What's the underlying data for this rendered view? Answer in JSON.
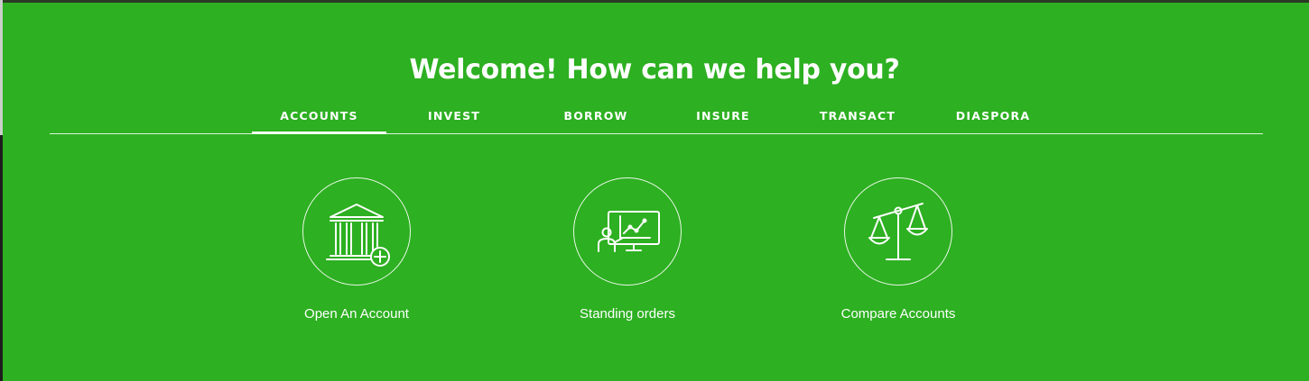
{
  "headline": "Welcome! How can we help you?",
  "tabs": [
    {
      "label": "ACCOUNTS",
      "active": true
    },
    {
      "label": "INVEST",
      "active": false
    },
    {
      "label": "BORROW",
      "active": false
    },
    {
      "label": "INSURE",
      "active": false
    },
    {
      "label": "TRANSACT",
      "active": false
    },
    {
      "label": "DIASPORA",
      "active": false
    }
  ],
  "cards": [
    {
      "label": "Open An Account",
      "icon": "bank-add-icon"
    },
    {
      "label": "Standing orders",
      "icon": "presentation-chart-icon"
    },
    {
      "label": "Compare Accounts",
      "icon": "balance-scale-icon"
    }
  ],
  "colors": {
    "background": "#2db021",
    "text": "#ffffff"
  }
}
